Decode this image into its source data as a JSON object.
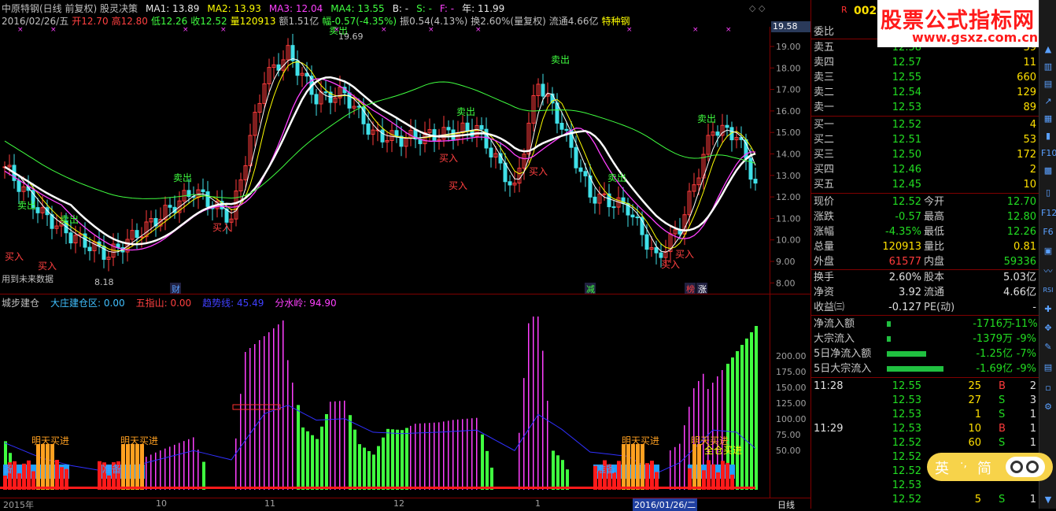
{
  "header": {
    "line1": [
      {
        "t": "中原特钢(日线 前复权) 股灵决策",
        "c": "#c0c0c0"
      },
      {
        "t": "MA1: 13.89",
        "c": "#e8e8e8"
      },
      {
        "t": "MA2: 13.93",
        "c": "#ffff00"
      },
      {
        "t": "MA3: 12.04",
        "c": "#ff40ff"
      },
      {
        "t": "MA4: 13.55",
        "c": "#40ff40"
      },
      {
        "t": "B: -",
        "c": "#e8e8e8"
      },
      {
        "t": "S: -",
        "c": "#40ff40"
      },
      {
        "t": "F: -",
        "c": "#ff40ff"
      },
      {
        "t": "年: 11.99",
        "c": "#e8e8e8"
      }
    ],
    "line2": [
      {
        "t": "2016/02/26/五",
        "c": "#c0c0c0"
      },
      {
        "t": "开12.70",
        "c": "#ff4040"
      },
      {
        "t": "高12.80",
        "c": "#ff4040"
      },
      {
        "t": "低12.26",
        "c": "#40ff40"
      },
      {
        "t": "收12.52",
        "c": "#40ff40"
      },
      {
        "t": "量120913",
        "c": "#ffff00"
      },
      {
        "t": "额1.51亿",
        "c": "#c0c0c0"
      },
      {
        "t": "幅-0.57(-4.35%)",
        "c": "#40ff40"
      },
      {
        "t": "振0.54(4.13%)",
        "c": "#c0c0c0"
      },
      {
        "t": "换2.60%(量复权)",
        "c": "#c0c0c0"
      },
      {
        "t": "流通4.66亿",
        "c": "#c0c0c0"
      },
      {
        "t": "特种钢",
        "c": "#ffff00"
      }
    ]
  },
  "price_axis": {
    "current": "19.58",
    "ticks": [
      "19.00",
      "18.00",
      "17.00",
      "16.00",
      "15.00",
      "14.00",
      "13.00",
      "12.00",
      "11.00",
      "10.00",
      "9.00",
      "8.00"
    ]
  },
  "annotations": {
    "high": "19.69",
    "low": "8.18",
    "future_data": "用到未来数据",
    "sell_label": "卖出",
    "buy_label": "买入",
    "cai": "财",
    "jian": "减",
    "bang": "榜",
    "zhang": "涨"
  },
  "indicator": {
    "items": [
      {
        "t": "城步建仓",
        "c": "#c0c0c0"
      },
      {
        "t": "大庄建仓区: 0.00",
        "c": "#40c0ff"
      },
      {
        "t": "五指山: 0.00",
        "c": "#ff4040"
      },
      {
        "t": "趋势线: 45.49",
        "c": "#4040ff"
      },
      {
        "t": "分水岭: 94.90",
        "c": "#ff40ff"
      }
    ],
    "ticks": [
      "200.00",
      "175.00",
      "150.00",
      "125.00",
      "100.00",
      "75.00",
      "50.00"
    ],
    "labels": {
      "buy_tomorrow": "明天买进",
      "prepare": "准备",
      "full": "全仓买进",
      "bei": "备"
    }
  },
  "x_axis": {
    "labels": [
      "2015年",
      "10",
      "11",
      "12",
      "1",
      "2016/01/26/二"
    ],
    "period": "日线"
  },
  "right_panel": {
    "code": "0024",
    "r_mark": "R",
    "weibi": "委比",
    "asks": [
      {
        "label": "卖五",
        "price": "12.58",
        "vol": "39"
      },
      {
        "label": "卖四",
        "price": "12.57",
        "vol": "11"
      },
      {
        "label": "卖三",
        "price": "12.55",
        "vol": "660"
      },
      {
        "label": "卖二",
        "price": "12.54",
        "vol": "129"
      },
      {
        "label": "卖一",
        "price": "12.53",
        "vol": "89"
      }
    ],
    "bids": [
      {
        "label": "买一",
        "price": "12.52",
        "vol": "4"
      },
      {
        "label": "买二",
        "price": "12.51",
        "vol": "53"
      },
      {
        "label": "买三",
        "price": "12.50",
        "vol": "172"
      },
      {
        "label": "买四",
        "price": "12.46",
        "vol": "2"
      },
      {
        "label": "买五",
        "price": "12.45",
        "vol": "10"
      }
    ],
    "quote": [
      {
        "l1": "现价",
        "v1": "12.52",
        "c1": "g",
        "l2": "今开",
        "v2": "12.70",
        "c2": "g"
      },
      {
        "l1": "涨跌",
        "v1": "-0.57",
        "c1": "g",
        "l2": "最高",
        "v2": "12.80",
        "c2": "g"
      },
      {
        "l1": "涨幅",
        "v1": "-4.35%",
        "c1": "g",
        "l2": "最低",
        "v2": "12.26",
        "c2": "g"
      },
      {
        "l1": "总量",
        "v1": "120913",
        "c1": "y",
        "l2": "量比",
        "v2": "0.81",
        "c2": "y"
      },
      {
        "l1": "外盘",
        "v1": "61577",
        "c1": "r",
        "l2": "内盘",
        "v2": "59336",
        "c2": "g"
      }
    ],
    "fin": [
      {
        "l1": "换手",
        "v1": "2.60%",
        "l2": "股本",
        "v2": "5.03亿"
      },
      {
        "l1": "净资",
        "v1": "3.92",
        "l2": "流通",
        "v2": "4.66亿"
      },
      {
        "l1": "收益㈢",
        "v1": "-0.127",
        "l2": "PE(动)",
        "v2": "-"
      }
    ],
    "flows": [
      {
        "label": "净流入额",
        "bar": 0.05,
        "v1": "-1716万",
        "v2": "-11%"
      },
      {
        "label": "大宗流入",
        "bar": 0.05,
        "v1": "-1379万",
        "v2": "-9%"
      },
      {
        "label": "5日净流入额",
        "bar": 0.55,
        "v1": "-1.25亿",
        "v2": "-7%"
      },
      {
        "label": "5日大宗流入",
        "bar": 0.8,
        "v1": "-1.69亿",
        "v2": "-9%"
      }
    ],
    "ticks": [
      {
        "time": "11:28",
        "price": "12.55",
        "vol": "25",
        "bs": "B",
        "n": "2"
      },
      {
        "time": "",
        "price": "12.53",
        "vol": "27",
        "bs": "S",
        "n": "3"
      },
      {
        "time": "",
        "price": "12.53",
        "vol": "1",
        "bs": "S",
        "n": "1"
      },
      {
        "time": "11:29",
        "price": "12.53",
        "vol": "10",
        "bs": "B",
        "n": "1"
      },
      {
        "time": "",
        "price": "12.52",
        "vol": "60",
        "bs": "S",
        "n": "1"
      },
      {
        "time": "",
        "price": "12.52",
        "vol": "",
        "bs": "",
        "n": ""
      },
      {
        "time": "",
        "price": "12.52",
        "vol": "",
        "bs": "",
        "n": ""
      },
      {
        "time": "",
        "price": "12.53",
        "vol": "",
        "bs": "",
        "n": ""
      },
      {
        "time": "",
        "price": "12.52",
        "vol": "5",
        "bs": "S",
        "n": "1"
      }
    ]
  },
  "logo": {
    "line1": "股票公式指标网",
    "line2": "www.gsxz.com.cn"
  },
  "ime": {
    "t1": "英",
    "t2": "·,",
    "t3": "简"
  },
  "colors": {
    "up": "#ff3b3b",
    "down": "#40e0e8",
    "ma_white": "#ffffff",
    "ma_yellow": "#ffff00",
    "ma_magenta": "#ff40ff",
    "ma_green": "#40ff40"
  }
}
